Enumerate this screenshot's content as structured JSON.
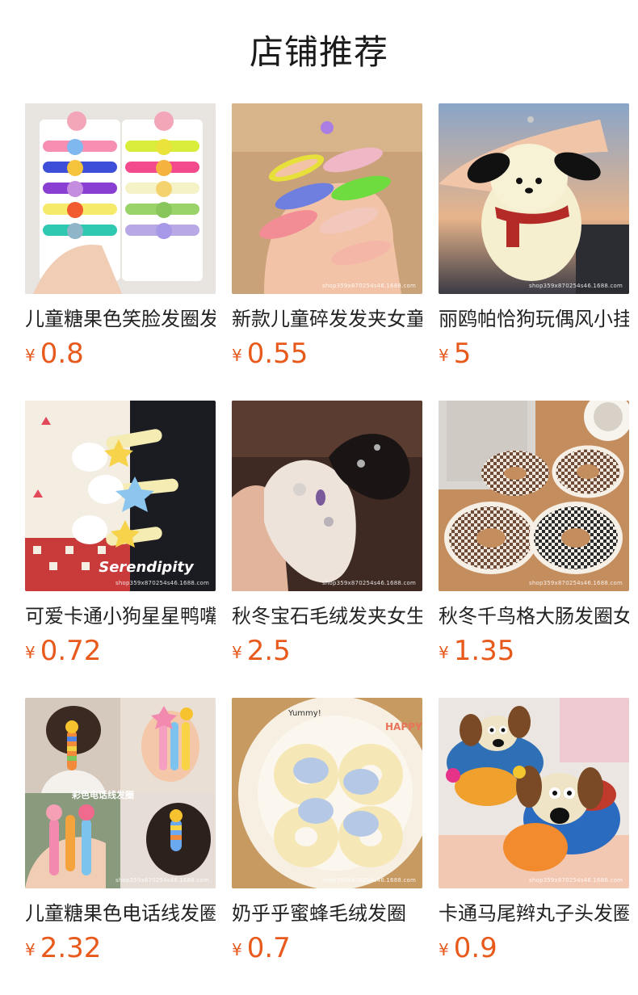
{
  "page": {
    "title": "店铺推荐"
  },
  "products": [
    {
      "name": "儿童糖果色笑脸发圈发绳",
      "currency": "¥",
      "price": "0.8",
      "watermark": "",
      "theme": "scrunchie-smiley"
    },
    {
      "name": "新款儿童碎发发夹女童",
      "currency": "¥",
      "price": "0.55",
      "watermark": "shop359x870254s46.1688.com",
      "theme": "carrot-clips"
    },
    {
      "name": "丽鸥帕恰狗玩偶风小挂件",
      "currency": "¥",
      "price": "5",
      "watermark": "shop359x870254s46.1688.com",
      "theme": "plush-dog"
    },
    {
      "name": "可爱卡通小狗星星鸭嘴夹",
      "currency": "¥",
      "price": "0.72",
      "watermark": "shop359x870254s46.1688.com",
      "theme": "cartoon-clips"
    },
    {
      "name": "秋冬宝石毛绒发夹女生",
      "currency": "¥",
      "price": "2.5",
      "watermark": "shop359x870254s46.1688.com",
      "theme": "fur-clips"
    },
    {
      "name": "秋冬千鸟格大肠发圈女",
      "currency": "¥",
      "price": "1.35",
      "watermark": "shop359x870254s46.1688.com",
      "theme": "houndstooth"
    },
    {
      "name": "儿童糖果色电话线发圈",
      "currency": "¥",
      "price": "2.32",
      "watermark": "shop359x870254s46.1688.com",
      "theme": "coil-ties"
    },
    {
      "name": "奶乎乎蜜蜂毛绒发圈",
      "currency": "¥",
      "price": "0.7",
      "watermark": "shop359x870254s46.1688.com",
      "theme": "bee-fluffy"
    },
    {
      "name": "卡通马尾辫丸子头发圈",
      "currency": "¥",
      "price": "0.9",
      "watermark": "shop359x870254s46.1688.com",
      "theme": "gromit"
    }
  ],
  "colors": {
    "price": "#e85a1c",
    "title": "#1a1a1a",
    "name": "#222222"
  }
}
